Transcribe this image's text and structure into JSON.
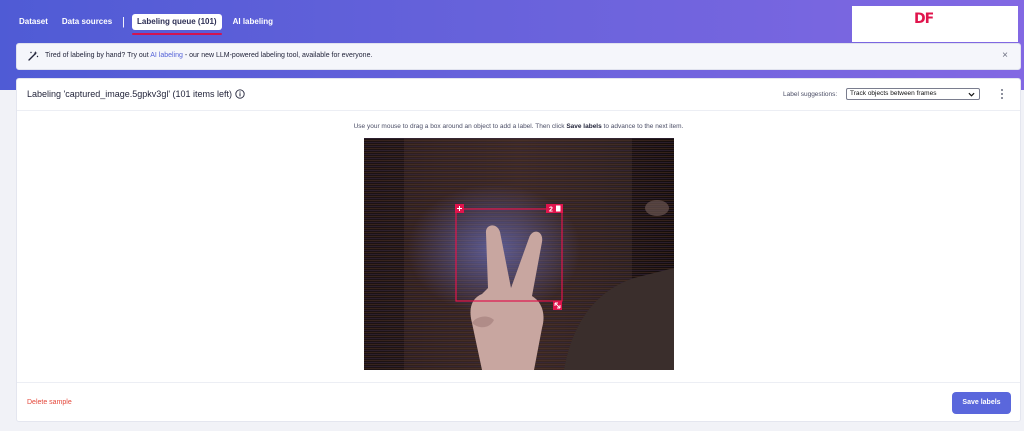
{
  "nav": {
    "items": [
      {
        "label": "Dataset"
      },
      {
        "label": "Data sources"
      },
      {
        "label": "Labeling queue (101)"
      },
      {
        "label": "AI labeling"
      }
    ],
    "active_index": 2
  },
  "brand": {
    "logo_text": "DF"
  },
  "banner": {
    "text_before": "Tired of labeling by hand? Try out ",
    "link_text": "AI labeling",
    "text_after": " - our new LLM-powered labeling tool, available for everyone.",
    "close_symbol": "×"
  },
  "labeling": {
    "title": "Labeling 'captured_image.5gpkv3gl' (101 items left)",
    "suggestions_label": "Label suggestions:",
    "suggestions_value": "Track objects between frames",
    "instructions_before": "Use your mouse to drag a box around an object to add a label. Then click ",
    "instructions_bold": "Save labels",
    "instructions_after": " to advance to the next item.",
    "box_label": "2"
  },
  "footer": {
    "delete_label": "Delete sample",
    "save_label": "Save labels"
  },
  "colors": {
    "header_start": "#4f5bd5",
    "header_end": "#8268e3",
    "accent": "#5a67dc",
    "bbox": "#e0144c",
    "delete": "#e4473a"
  }
}
